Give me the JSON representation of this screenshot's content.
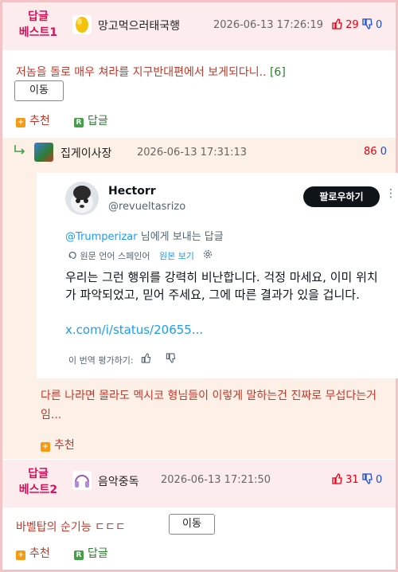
{
  "best1": {
    "tag_line1": "답글",
    "tag_line2": "베스트1",
    "nick": "망고먹으러태국행",
    "date": "2026-06-13 17:26:19",
    "up": "29",
    "down": "0",
    "text": "저놈을 돌로 매우 쳐라를 지구반대편에서 보게되다니..",
    "reply_count": "[6]",
    "move_label": "이동",
    "recommend_label": "추천",
    "reply_label": "답글"
  },
  "sub": {
    "nick": "집게이사장",
    "date": "2026-06-13 17:31:13",
    "up": "86",
    "down": "0",
    "text": "다른 나라면 몰라도 멕시코 형님들이 이렇게 말하는건 진짜로 무섭다는거임...",
    "recommend_label": "추천",
    "tweet": {
      "name": "Hectorr",
      "handle": "@revueltasrizo",
      "follow_label": "팔로우하기",
      "mention": "@Trumperizar",
      "reply_suffix": " 님에게 보내는 답글",
      "translated_from": "원문 언어 스페인어",
      "view_original": "원본 보기",
      "body": "우리는 그런 행위를 강력히 비난합니다. 걱정 마세요, 이미 위치가 파악되었고, 믿어 주세요, 그에 따른 결과가 있을 겁니다.",
      "link": "x.com/i/status/20655...",
      "rate_label": "이 번역 평가하기:"
    }
  },
  "best2": {
    "tag_line1": "답글",
    "tag_line2": "베스트2",
    "nick": "음악중독",
    "date": "2026-06-13 17:21:50",
    "up": "31",
    "down": "0",
    "text": "바벨탑의 순기능 ㄷㄷㄷ",
    "move_label": "이동",
    "recommend_label": "추천",
    "reply_label": "답글"
  },
  "colors": {
    "best_bg": "#fdecee",
    "sub_bg": "#fdf0e6",
    "accent_red": "#d4145a",
    "up_red": "#e60012",
    "down_blue": "#1a4ccc",
    "tweet_link": "#1d9bf0"
  }
}
